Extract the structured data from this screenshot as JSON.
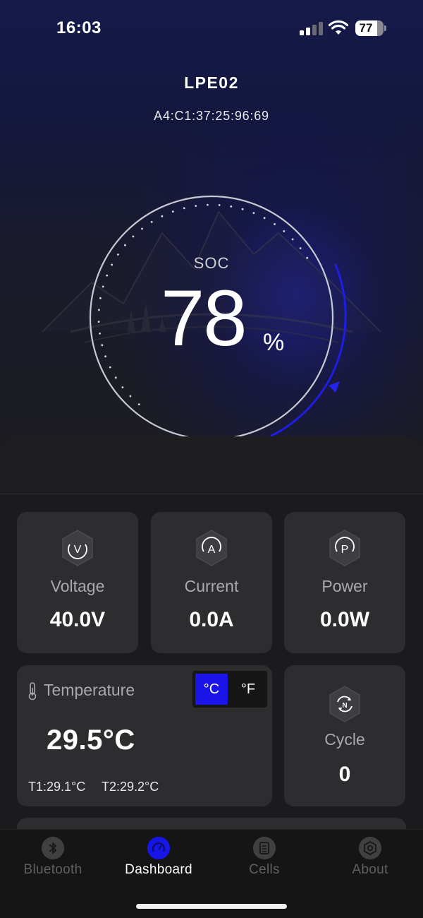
{
  "status_bar": {
    "time": "16:03",
    "battery": "77"
  },
  "device": {
    "name": "LPE02",
    "mac": "A4:C1:37:25:96:69"
  },
  "soc": {
    "label": "SOC",
    "value": "78",
    "unit": "%",
    "level": 0.78
  },
  "metrics": [
    {
      "label": "Voltage",
      "value": "40.0V",
      "icon_letter": "V",
      "icon": "voltage-icon"
    },
    {
      "label": "Current",
      "value": "0.0A",
      "icon_letter": "A",
      "icon": "current-icon"
    },
    {
      "label": "Power",
      "value": "0.0W",
      "icon_letter": "P",
      "icon": "power-icon"
    }
  ],
  "temperature": {
    "title": "Temperature",
    "value": "29.5°C",
    "unit_celsius": "°C",
    "unit_fahrenheit": "°F",
    "selected_unit": "°C",
    "t1": "T1:29.1°C",
    "t2": "T2:29.2°C"
  },
  "cycle": {
    "label": "Cycle",
    "value": "0",
    "icon": "cycle-icon"
  },
  "tabs": [
    {
      "label": "Bluetooth",
      "icon": "bluetooth-icon",
      "active": false
    },
    {
      "label": "Dashboard",
      "icon": "dashboard-icon",
      "active": true
    },
    {
      "label": "Cells",
      "icon": "cells-icon",
      "active": false
    },
    {
      "label": "About",
      "icon": "about-icon",
      "active": false
    }
  ],
  "colors": {
    "accent": "#1b14e8",
    "card": "#2d2d2f",
    "background": "#1a1a1c",
    "muted_text": "#a9a9ad"
  }
}
